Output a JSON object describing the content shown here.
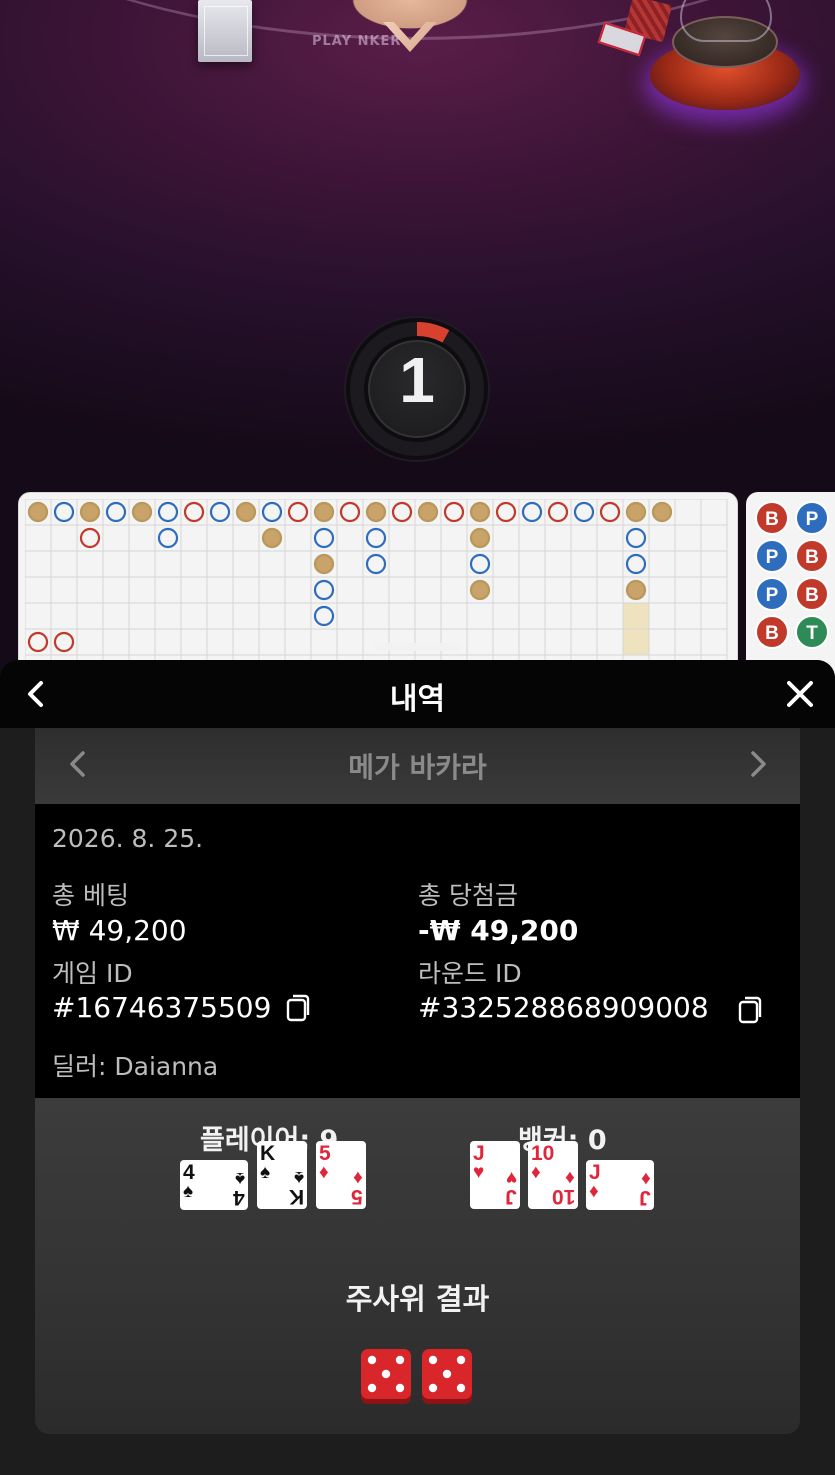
{
  "video": {
    "felt_label": "PLAY      NKER",
    "countdown": "1",
    "countdown_progress": 0.08
  },
  "roadmap_side": {
    "cells": [
      "B",
      "P",
      "P",
      "B",
      "P",
      "B",
      "B",
      "T"
    ]
  },
  "sheet": {
    "title": "내역",
    "back_icon": "chevron-left-icon",
    "close_icon": "close-icon"
  },
  "game_nav": {
    "name": "메가 바카라"
  },
  "details": {
    "date": "2026. 8. 25.",
    "total_bet_label": "총 베팅",
    "total_bet_value": "₩ 49,200",
    "total_win_label": "총 당첨금",
    "total_win_value": "-₩ 49,200",
    "game_id_label": "게임 ID",
    "game_id_value": "#16746375509",
    "round_id_label": "라운드 ID",
    "round_id_value": "#332528868909008",
    "dealer": "딜러: Daianna"
  },
  "result": {
    "player_label": "플레이어: 9",
    "banker_label": "뱅커: 0",
    "player_cards": [
      {
        "rank": "4",
        "suit": "♠",
        "color": "#111111",
        "orientation": "sideways"
      },
      {
        "rank": "K",
        "suit": "♠",
        "color": "#111111",
        "orientation": "upright"
      },
      {
        "rank": "5",
        "suit": "♦",
        "color": "#e0263a",
        "orientation": "upright"
      }
    ],
    "banker_cards": [
      {
        "rank": "J",
        "suit": "♥",
        "color": "#e0263a",
        "orientation": "upright"
      },
      {
        "rank": "10",
        "suit": "♦",
        "color": "#e0263a",
        "orientation": "upright"
      },
      {
        "rank": "J",
        "suit": "♦",
        "color": "#e0263a",
        "orientation": "sideways"
      }
    ],
    "dice_title": "주사위 결과",
    "dice": [
      5,
      5
    ]
  },
  "colors": {
    "banker_red": "#c0392b",
    "player_blue": "#2e6dbd",
    "tie_green": "#2e8b57",
    "gold": "#b8975a"
  }
}
